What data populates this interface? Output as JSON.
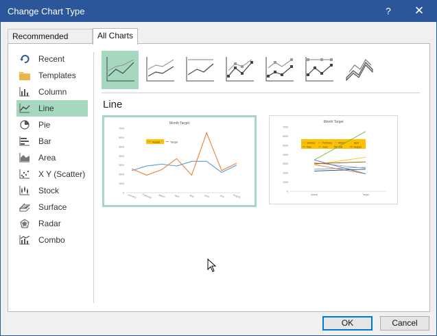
{
  "window": {
    "title": "Change Chart Type",
    "help_label": "?",
    "close_label": "✕"
  },
  "tabs": [
    {
      "label": "Recommended Charts",
      "active": false
    },
    {
      "label": "All Charts",
      "active": true
    }
  ],
  "sidebar": {
    "items": [
      {
        "label": "Recent",
        "icon": "recent-icon"
      },
      {
        "label": "Templates",
        "icon": "folder-icon"
      },
      {
        "label": "Column",
        "icon": "column-chart-icon"
      },
      {
        "label": "Line",
        "icon": "line-chart-icon",
        "selected": true
      },
      {
        "label": "Pie",
        "icon": "pie-chart-icon"
      },
      {
        "label": "Bar",
        "icon": "bar-chart-icon"
      },
      {
        "label": "Area",
        "icon": "area-chart-icon"
      },
      {
        "label": "X Y (Scatter)",
        "icon": "scatter-chart-icon"
      },
      {
        "label": "Stock",
        "icon": "stock-chart-icon"
      },
      {
        "label": "Surface",
        "icon": "surface-chart-icon"
      },
      {
        "label": "Radar",
        "icon": "radar-chart-icon"
      },
      {
        "label": "Combo",
        "icon": "combo-chart-icon"
      }
    ]
  },
  "subtypes": [
    {
      "icon": "line-icon",
      "selected": true
    },
    {
      "icon": "stacked-line-icon"
    },
    {
      "icon": "100-stacked-line-icon"
    },
    {
      "icon": "line-with-markers-icon"
    },
    {
      "icon": "stacked-line-with-markers-icon"
    },
    {
      "icon": "100-stacked-line-with-markers-icon"
    },
    {
      "icon": "3d-line-icon"
    }
  ],
  "section_title": "Line",
  "previews": [
    {
      "title": "Month Target",
      "legend": [
        "Actual",
        "Target"
      ],
      "categories": [
        "January",
        "February",
        "March",
        "April",
        "May",
        "June",
        "July",
        "August"
      ],
      "series": [
        {
          "name": "Actual",
          "color": "#5b9bd5",
          "values": [
            2400,
            2900,
            3100,
            2900,
            3400,
            3400,
            2200,
            3000
          ]
        },
        {
          "name": "Target",
          "color": "#ed7d31",
          "values": [
            2600,
            1900,
            2500,
            3700,
            1900,
            6500,
            2400,
            3200
          ]
        }
      ],
      "yticks": [
        "7000",
        "6000",
        "5000",
        "4000",
        "3000",
        "2000",
        "1000",
        "0"
      ],
      "selected": true
    },
    {
      "title": "Month Target",
      "legend": [
        "January",
        "February",
        "March",
        "April",
        "May",
        "June",
        "July",
        "August"
      ],
      "categories": [
        "Actual",
        "Target"
      ],
      "yticks": [
        "7000",
        "6000",
        "5000",
        "4000",
        "3000",
        "2000",
        "1000",
        "0"
      ]
    }
  ],
  "buttons": {
    "ok": "OK",
    "cancel": "Cancel"
  },
  "colors": {
    "titlebar": "#2b579a",
    "selection": "#a6d8bf",
    "legend_bg": "#ffc000"
  }
}
